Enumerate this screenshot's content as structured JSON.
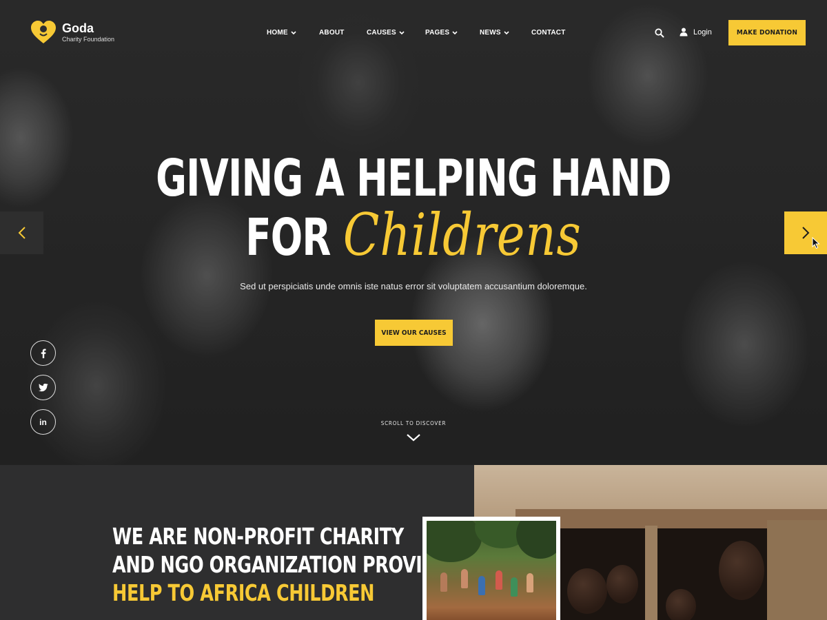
{
  "brand": {
    "name": "Goda",
    "tagline": "Charity Foundation"
  },
  "nav": [
    {
      "label": "HOME",
      "dropdown": true
    },
    {
      "label": "ABOUT",
      "dropdown": false
    },
    {
      "label": "CAUSES",
      "dropdown": true
    },
    {
      "label": "PAGES",
      "dropdown": true
    },
    {
      "label": "NEWS",
      "dropdown": true
    },
    {
      "label": "CONTACT",
      "dropdown": false
    }
  ],
  "header": {
    "login_label": "Login",
    "donate_label": "MAKE DONATION",
    "search_icon": "search-icon",
    "user_icon": "user-icon"
  },
  "hero": {
    "line1": "GIVING A HELPING HAND",
    "line2_prefix": "FOR",
    "line2_script": "Childrens",
    "subtitle": "Sed ut perspiciatis unde omnis iste natus error sit voluptatem accusantium doloremque.",
    "cta_label": "VIEW OUR CAUSES",
    "scroll_label": "SCROLL TO DISCOVER"
  },
  "social": [
    {
      "name": "facebook",
      "glyph": "f"
    },
    {
      "name": "twitter",
      "glyph": "t"
    },
    {
      "name": "linkedin",
      "glyph": "in"
    }
  ],
  "about": {
    "line1": "WE ARE NON-PROFIT CHARITY",
    "line2": "AND NGO ORGANIZATION PROVIDE",
    "line3": "HELP TO AFRICA CHILDREN"
  },
  "colors": {
    "accent": "#f7c935",
    "dark": "#2e2e2f",
    "text": "#ffffff"
  }
}
